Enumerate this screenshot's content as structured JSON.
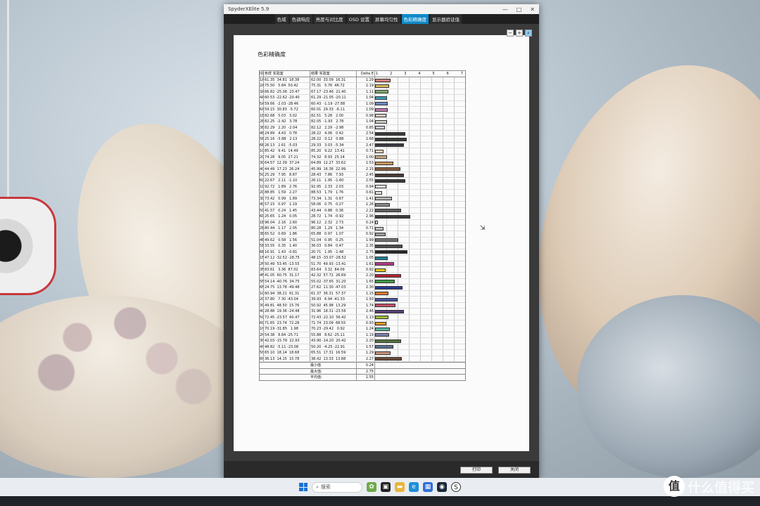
{
  "window": {
    "title": "SpyderXElite 5.9",
    "controls": [
      "—",
      "□",
      "✕"
    ]
  },
  "tabs": [
    {
      "label": "色域",
      "active": false
    },
    {
      "label": "色调响应",
      "active": false
    },
    {
      "label": "亮度与对比度",
      "active": false
    },
    {
      "label": "OSD 设置",
      "active": false
    },
    {
      "label": "屏幕均匀性",
      "active": false
    },
    {
      "label": "色彩精确度",
      "active": true
    },
    {
      "label": "显示器验证值",
      "active": false
    }
  ],
  "toolbar_icons": [
    "zoom-out-icon",
    "zoom-in-icon",
    "zoom-fit-icon"
  ],
  "report": {
    "title": "色彩精确度",
    "columns": {
      "id": "ID",
      "reference": "色样  实验室",
      "measured": "结果  实验室",
      "delta": "Delta E",
      "scale": [
        "1",
        "2",
        "3",
        "4",
        "5",
        "6",
        "7"
      ]
    },
    "rows": [
      {
        "id": "1A",
        "ref": "61.35  34.81  18.38",
        "meas": "62.00  33.09  16.31",
        "de": "1.29",
        "color": "#d47f7a"
      },
      {
        "id": "2A",
        "ref": "75.50   5.84  50.42",
        "meas": "75.31   5.76  46.72",
        "de": "1.19",
        "color": "#d9b95a"
      },
      {
        "id": "3A",
        "ref": "66.82 -25.06  23.47",
        "meas": "67.17 -23.46  21.40",
        "de": "1.11",
        "color": "#7fa86a"
      },
      {
        "id": "4A",
        "ref": "60.53 -22.62 -20.40",
        "meas": "61.29 -21.05 -20.11",
        "de": "1.04",
        "color": "#3f9cbf"
      },
      {
        "id": "5A",
        "ref": "59.66  -2.03 -28.46",
        "meas": "60.43  -1.19 -27.88",
        "de": "1.09",
        "color": "#6c88c2"
      },
      {
        "id": "6A",
        "ref": "59.15  30.83  -5.72",
        "meas": "60.01  29.33  -6.11",
        "de": "1.09",
        "color": "#c07ab2"
      },
      {
        "id": "1B",
        "ref": "82.68   5.03   3.02",
        "meas": "82.51   5.28   2.00",
        "de": "0.98",
        "color": "#d6c9c4"
      },
      {
        "id": "2B",
        "ref": "82.25  -2.42   3.78",
        "meas": "82.05  -1.93   2.78",
        "de": "1.04",
        "color": "#c9cdc2"
      },
      {
        "id": "3B",
        "ref": "82.29   2.20  -2.04",
        "meas": "82.12   2.29  -2.98",
        "de": "0.85",
        "color": "#cbcad2"
      },
      {
        "id": "4B",
        "ref": "24.89   4.43   0.78",
        "meas": "28.22   4.06   0.42",
        "de": "2.54",
        "color": "#3d393a"
      },
      {
        "id": "5B",
        "ref": "25.16  -3.88   2.13",
        "meas": "28.22  -3.12   0.88",
        "de": "2.68",
        "color": "#393d39"
      },
      {
        "id": "6B",
        "ref": "26.13   2.61  -5.03",
        "meas": "29.33   3.03  -5.34",
        "de": "2.47",
        "color": "#3b3a42"
      },
      {
        "id": "1C",
        "ref": "85.42   9.41  14.49",
        "meas": "85.20   9.22  13.41",
        "de": "0.71",
        "color": "#e6cdb7"
      },
      {
        "id": "2C",
        "ref": "74.28   9.05  27.21",
        "meas": "74.32   8.93  25.14",
        "de": "1.00",
        "color": "#ccab85"
      },
      {
        "id": "3C",
        "ref": "64.57  12.39  37.24",
        "meas": "64.89  12.27  33.62",
        "de": "1.53",
        "color": "#c9955a"
      },
      {
        "id": "4C",
        "ref": "44.49  17.23  26.24",
        "meas": "45.99  16.36  22.99",
        "de": "2.15",
        "color": "#8a5c3e"
      },
      {
        "id": "5C",
        "ref": "25.29   7.95   8.87",
        "meas": "28.43   7.86   7.93",
        "de": "2.45",
        "color": "#4a3a35"
      },
      {
        "id": "6C",
        "ref": "22.67   2.11  -1.10",
        "meas": "26.11   1.95  -1.60",
        "de": "2.55",
        "color": "#383738"
      },
      {
        "id": "1D",
        "ref": "92.72   1.89   2.76",
        "meas": "92.95   2.33   2.03",
        "de": "0.94",
        "color": "#efeae6"
      },
      {
        "id": "2D",
        "ref": "88.85   1.59   2.27",
        "meas": "88.53   1.79   1.76",
        "de": "0.61",
        "color": "#e4e0dc"
      },
      {
        "id": "3D",
        "ref": "73.42   0.99   1.89",
        "meas": "73.34   1.31   0.67",
        "de": "1.41",
        "color": "#b5b3af"
      },
      {
        "id": "4D",
        "ref": "57.15   0.97   1.19",
        "meas": "58.06   0.75   0.27",
        "de": "1.26",
        "color": "#8b8a88"
      },
      {
        "id": "5D",
        "ref": "41.57   0.24   1.45",
        "meas": "43.44   0.88   0.36",
        "de": "2.22",
        "color": "#605f5d"
      },
      {
        "id": "6D",
        "ref": "25.65   1.24   0.05",
        "meas": "28.72   1.74  -0.92",
        "de": "2.96",
        "color": "#3e3d3d"
      },
      {
        "id": "1E",
        "ref": "96.04   2.16   2.60",
        "meas": "96.12   2.32   2.73",
        "de": "0.24",
        "color": "#f7f3ef"
      },
      {
        "id": "2E",
        "ref": "80.44   1.17   2.05",
        "meas": "80.28   1.29   1.34",
        "de": "0.71",
        "color": "#c7c4c0"
      },
      {
        "id": "3E",
        "ref": "65.52   0.69   1.86",
        "meas": "65.88   0.97   1.07",
        "de": "0.92",
        "color": "#9e9c99"
      },
      {
        "id": "4E",
        "ref": "49.62   0.58   1.56",
        "meas": "51.04   0.95   0.25",
        "de": "1.99",
        "color": "#767573"
      },
      {
        "id": "5E",
        "ref": "33.55   0.35   1.40",
        "meas": "36.03   0.84   0.47",
        "de": "2.35",
        "color": "#4f4e4d"
      },
      {
        "id": "6E",
        "ref": "16.91   1.43  -0.81",
        "meas": "20.71   1.95  -1.48",
        "de": "2.75",
        "color": "#2a292a"
      },
      {
        "id": "1F",
        "ref": "47.12 -32.52 -28.75",
        "meas": "48.15 -33.07 -28.52",
        "de": "1.05",
        "color": "#1d7f9c"
      },
      {
        "id": "2F",
        "ref": "50.49  53.45 -13.55",
        "meas": "51.70  49.93 -13.41",
        "de": "1.61",
        "color": "#b23a87"
      },
      {
        "id": "3F",
        "ref": "83.61   3.36  87.02",
        "meas": "83.64   3.32  84.09",
        "de": "0.92",
        "color": "#e8c520"
      },
      {
        "id": "4F",
        "ref": "41.05  60.75  31.17",
        "meas": "42.32  57.72  26.69",
        "de": "2.20",
        "color": "#b52435"
      },
      {
        "id": "5F",
        "ref": "54.14 -40.76  34.75",
        "meas": "55.02 -37.65  31.20",
        "de": "1.65",
        "color": "#3f9a45"
      },
      {
        "id": "6F",
        "ref": "24.75  13.78 -49.48",
        "meas": "27.62  11.30 -47.03",
        "de": "2.30",
        "color": "#283a90"
      },
      {
        "id": "1G",
        "ref": "60.94  38.21  61.31",
        "meas": "61.37  36.31  57.37",
        "de": "1.15",
        "color": "#dc7a2a"
      },
      {
        "id": "2G",
        "ref": "37.80   7.30 -43.04",
        "meas": "39.93   6.94 -41.33",
        "de": "1.93",
        "color": "#4556a0"
      },
      {
        "id": "3G",
        "ref": "49.81  48.50  15.76",
        "meas": "50.92  45.98  13.29",
        "de": "1.74",
        "color": "#c4506a"
      },
      {
        "id": "4G",
        "ref": "28.88  19.36 -24.48",
        "meas": "31.96  18.31 -23.56",
        "de": "2.46",
        "color": "#583e77"
      },
      {
        "id": "5G",
        "ref": "72.45 -23.57  60.47",
        "meas": "72.43 -22.10  56.42",
        "de": "1.13",
        "color": "#9ebc3a"
      },
      {
        "id": "6G",
        "ref": "71.65  23.74  72.28",
        "meas": "71.74  23.09  68.55",
        "de": "0.93",
        "color": "#e29a23"
      },
      {
        "id": "1H",
        "ref": "70.19 -31.85   1.98",
        "meas": "70.23 -29.42   0.92",
        "de": "1.24",
        "color": "#52b89e"
      },
      {
        "id": "2H",
        "ref": "54.38   8.84 -25.71",
        "meas": "55.88   8.62 -25.11",
        "de": "1.19",
        "color": "#7f82ad"
      },
      {
        "id": "3H",
        "ref": "42.03 -15.78  22.93",
        "meas": "43.90 -14.20  20.42",
        "de": "2.20",
        "color": "#53723a"
      },
      {
        "id": "4H",
        "ref": "48.82  -5.11 -23.08",
        "meas": "50.20  -4.25 -22.91",
        "de": "1.57",
        "color": "#5a7193"
      },
      {
        "id": "5H",
        "ref": "65.10  18.14  18.68",
        "meas": "65.51  17.31  16.59",
        "de": "1.29",
        "color": "#c59179"
      },
      {
        "id": "6H",
        "ref": "36.13  14.15  15.78",
        "meas": "38.42  13.33  13.88",
        "de": "2.27",
        "color": "#6a4a3a"
      }
    ],
    "summary": [
      {
        "label": "最小值",
        "value": "0.24"
      },
      {
        "label": "最大值:",
        "value": "2.75"
      },
      {
        "label": "平均值:",
        "value": "1.55"
      }
    ]
  },
  "buttons": {
    "print": "打印",
    "close": "关闭"
  },
  "taskbar": {
    "search_placeholder": "搜索",
    "icons": [
      "start-icon",
      "search-icon",
      "widgets-icon",
      "task-view-icon",
      "file-explorer-icon",
      "edge-icon",
      "store-icon",
      "steam-icon",
      "app-icon"
    ]
  },
  "watermark": {
    "logo": "值",
    "text": "什么值得买"
  }
}
